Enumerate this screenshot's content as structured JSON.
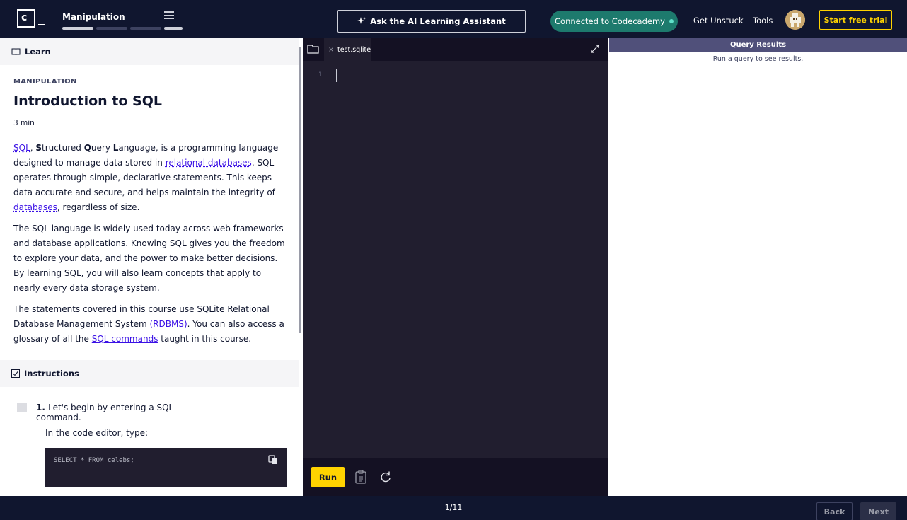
{
  "header": {
    "logo_text": "c",
    "module_title": "Manipulation",
    "assistant_label": "Ask the AI Learning Assistant",
    "connected_label": "Connected to Codecademy",
    "get_unstuck": "Get Unstuck",
    "tools": "Tools",
    "trial_label": "Start free trial"
  },
  "learn": {
    "section_label": "Learn",
    "eyebrow": "MANIPULATION",
    "title": "Introduction to SQL",
    "duration": "3 min",
    "p1": {
      "link_sql": "SQL",
      "s1": ", ",
      "b1": "S",
      "t1": "tructured ",
      "b2": "Q",
      "t2": "uery ",
      "b3": "L",
      "t3": "anguage, is a programming language designed to manage data stored in ",
      "link_relational": "relational databases",
      "t4": ". SQL operates through simple, declarative statements. This keeps data accurate and secure, and helps maintain the integrity of ",
      "link_databases": "databases",
      "t5": ", regardless of size."
    },
    "p2": "The SQL language is widely used today across web frameworks and database applications. Knowing SQL gives you the freedom to explore your data, and the power to make better decisions. By learning SQL, you will also learn concepts that apply to nearly every data storage system.",
    "p3": {
      "t1": "The statements covered in this course use SQLite Relational Database Management System ",
      "link_rdbms": "(RDBMS)",
      "t2": ". You can also access a glossary of all the ",
      "link_commands": "SQL commands",
      "t3": " taught in this course."
    }
  },
  "instructions": {
    "section_label": "Instructions",
    "step_number": "1.",
    "step_text": "Let's begin by entering a SQL command.",
    "step_sub": "In the code editor, type:",
    "code": "SELECT * FROM celebs;"
  },
  "editor": {
    "tab_close": "×",
    "tab_name": "test.sqlite",
    "line_number": "1",
    "run_label": "Run"
  },
  "results": {
    "header": "Query Results",
    "message": "Run a query to see results."
  },
  "footer": {
    "page_count": "1/11",
    "back_label": "Back",
    "next_label": "Next"
  },
  "colors": {
    "nav_bg": "#10162f",
    "accent_yellow": "#ffd300",
    "connected_green": "#1d7a6d",
    "link_blue": "#3a10e5",
    "editor_bg": "#211e2f"
  }
}
